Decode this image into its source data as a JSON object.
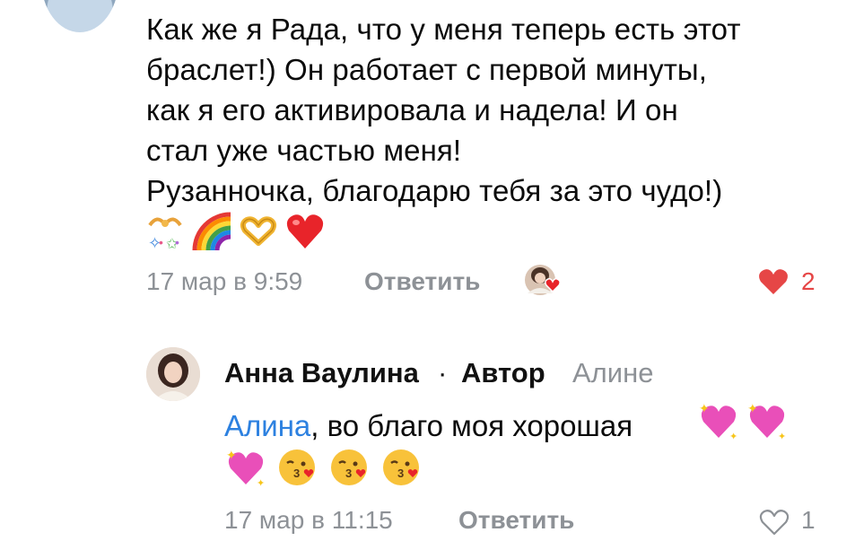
{
  "comment": {
    "lines": [
      "Как же я Рада, что у меня теперь есть этот",
      "браслет!) Он работает с первой минуты,",
      "как я его активировала и надела! И он",
      "стал уже частью меня!",
      "Рузанночка, благодарю тебя за это чудо!)"
    ],
    "emojis": [
      "party-popper-icon",
      "rainbow-icon",
      "heart-hands-icon",
      "red-heart-icon"
    ],
    "date": "17 мар в 9:59",
    "reply_label": "Ответить",
    "like_count": "2",
    "liked": true
  },
  "reply": {
    "author": "Анна Ваулина",
    "separator": "·",
    "author_tag": "Автор",
    "reply_to": "Алине",
    "mention": "Алина",
    "text": ", во благо моя хорошая",
    "emojis_line1": [
      "sparkling-heart-icon",
      "sparkling-heart-icon"
    ],
    "emojis_line2": [
      "sparkling-heart-icon",
      "kissing-face-icon",
      "kissing-face-icon",
      "kissing-face-icon"
    ],
    "date": "17 мар в 11:15",
    "reply_label": "Ответить",
    "like_count": "1",
    "liked": false
  },
  "colors": {
    "meta_gray": "#8d9196",
    "like_red": "#e64646",
    "mention_blue": "#2d81e0"
  }
}
